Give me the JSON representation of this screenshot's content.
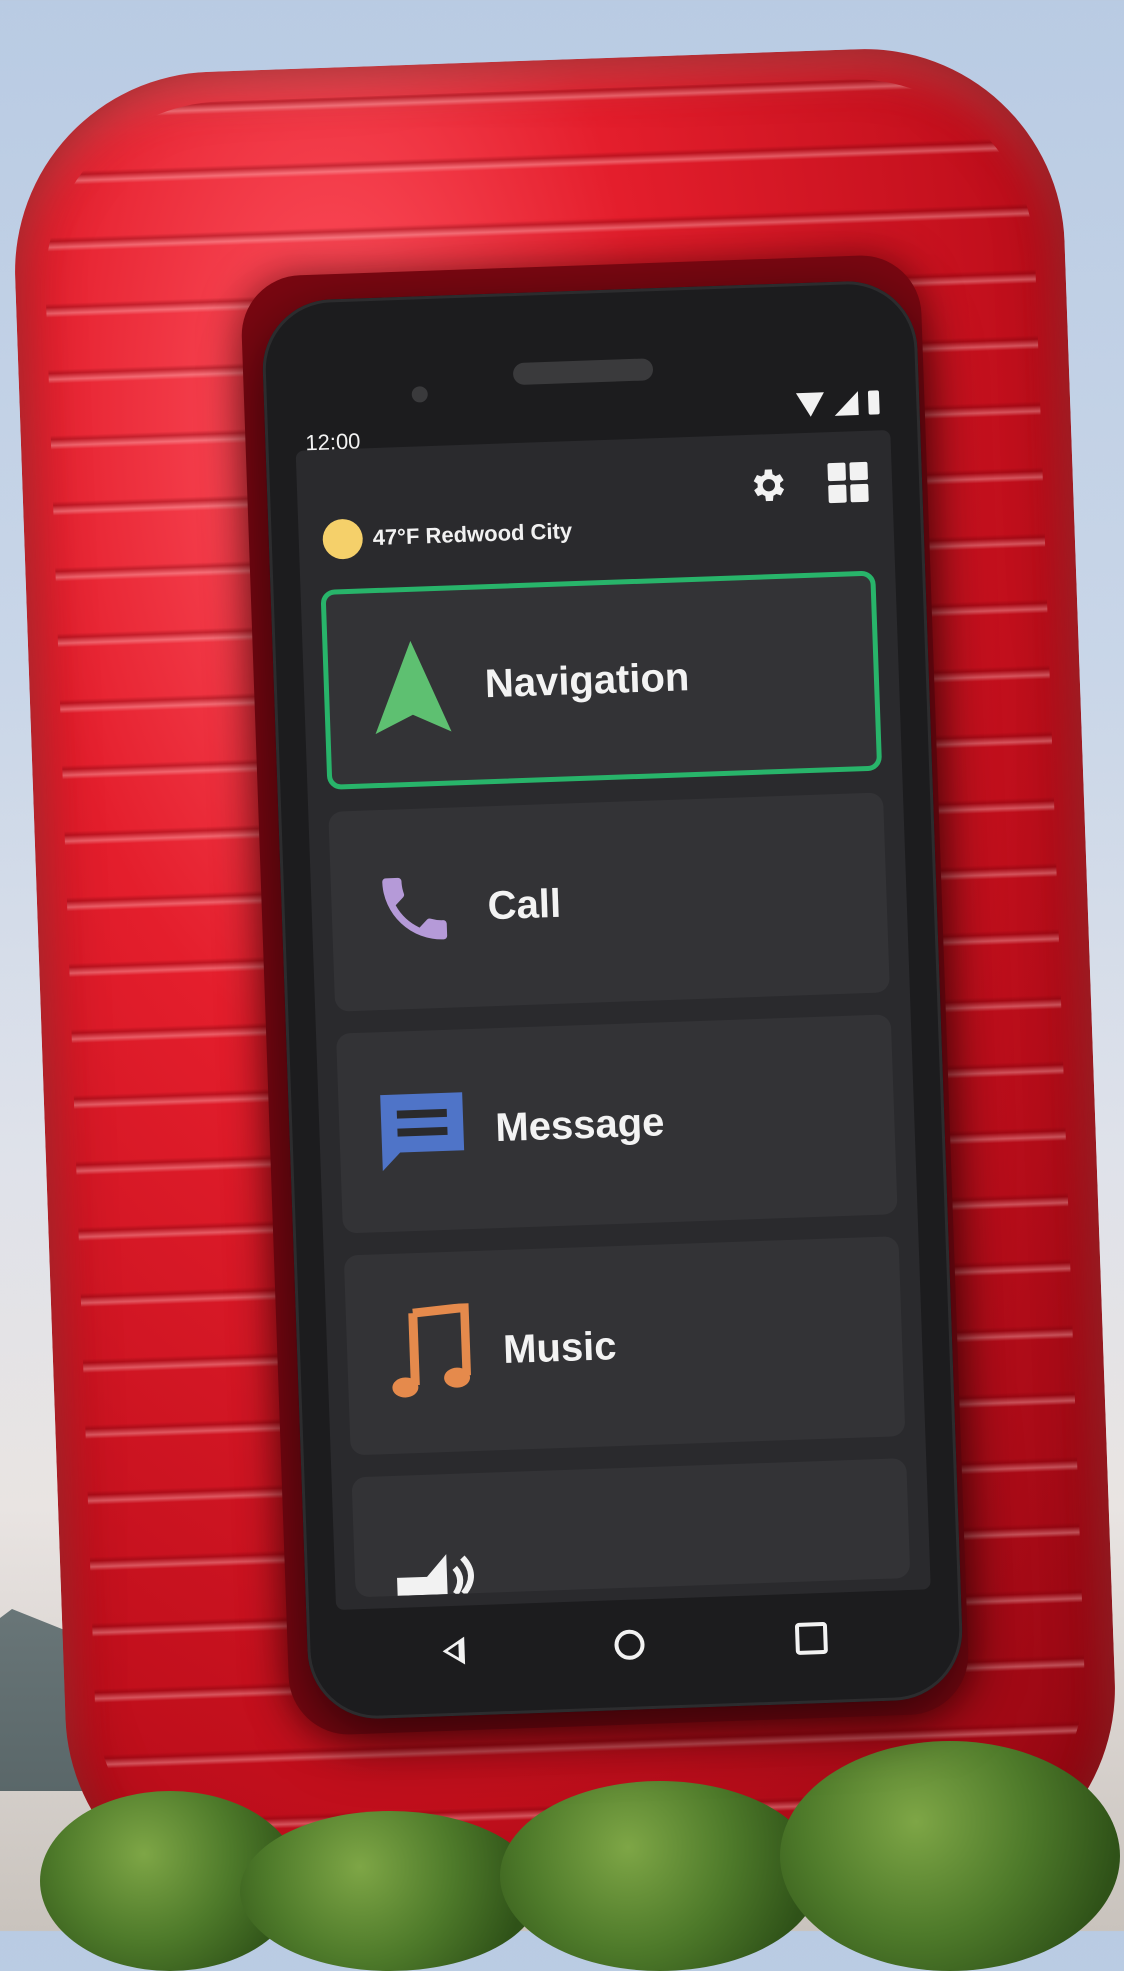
{
  "status_bar": {
    "time": "12:00"
  },
  "header": {
    "weather": "47°F Redwood City"
  },
  "menu": {
    "items": [
      {
        "label": "Navigation",
        "icon": "navigation-arrow-icon",
        "color": "#5ec071",
        "selected": true
      },
      {
        "label": "Call",
        "icon": "phone-icon",
        "color": "#b59ad8",
        "selected": false
      },
      {
        "label": "Message",
        "icon": "message-icon",
        "color": "#4f74c8",
        "selected": false
      },
      {
        "label": "Music",
        "icon": "music-note-icon",
        "color": "#e58a4c",
        "selected": false
      },
      {
        "label": "",
        "icon": "speaker-volume-icon",
        "color": "#f2f2f2",
        "selected": false
      }
    ]
  },
  "colors": {
    "selection_border": "#28b46a",
    "frame": "#e41e2c",
    "screen_bg": "#2a2a2d"
  }
}
